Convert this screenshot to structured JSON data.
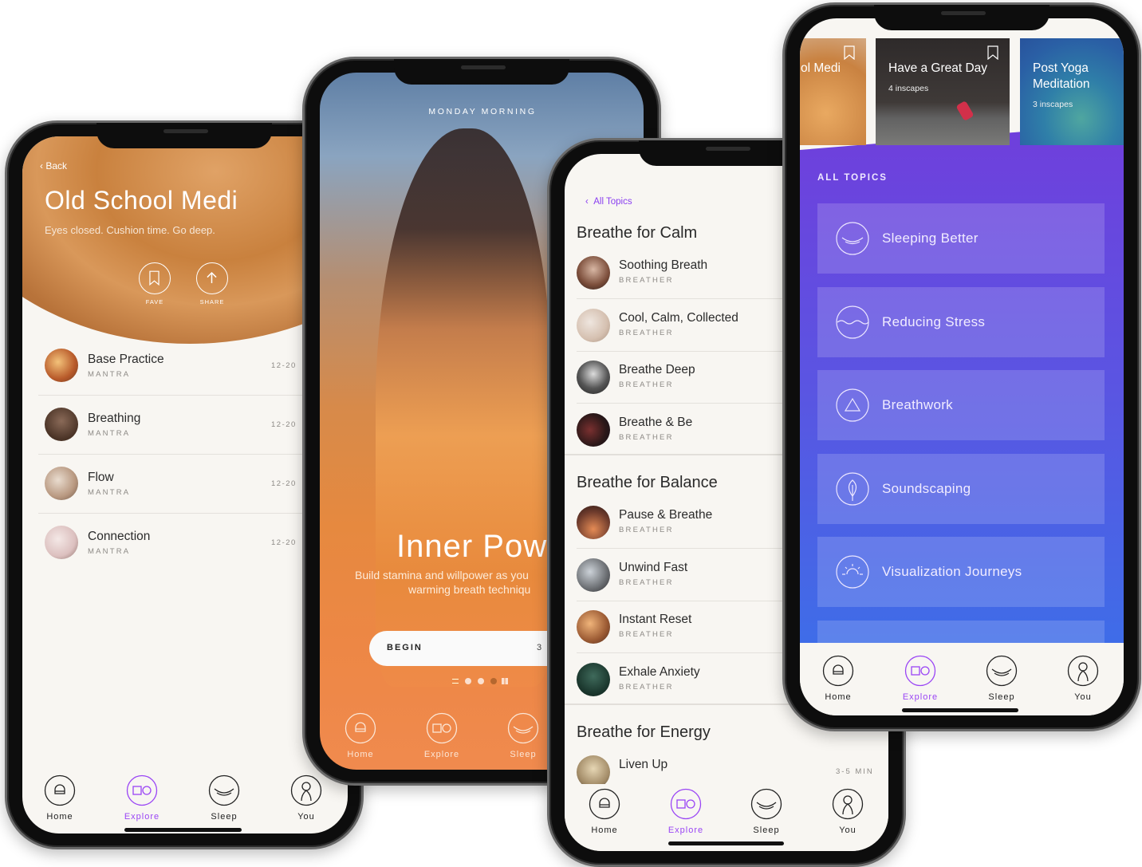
{
  "colors": {
    "accent": "#9a45f5",
    "cream": "#f8f6f2",
    "topics_top": "#6f3fdc",
    "topics_bottom": "#3e6de8"
  },
  "p1": {
    "back_label": "Back",
    "title": "Old School Medi",
    "subtitle": "Eyes closed. Cushion time. Go deep.",
    "fave_label": "FAVE",
    "share_label": "SHARE",
    "items": [
      {
        "title": "Base Practice",
        "subtitle": "MANTRA",
        "duration": "12-20"
      },
      {
        "title": "Breathing",
        "subtitle": "MANTRA",
        "duration": "12-20"
      },
      {
        "title": "Flow",
        "subtitle": "MANTRA",
        "duration": "12-20"
      },
      {
        "title": "Connection",
        "subtitle": "MANTRA",
        "duration": "12-20"
      }
    ],
    "active_tab": 1,
    "tabs": [
      {
        "label": "Home",
        "icon": "home-icon"
      },
      {
        "label": "Explore",
        "icon": "explore-icon"
      },
      {
        "label": "Sleep",
        "icon": "sleep-icon"
      },
      {
        "label": "You",
        "icon": "you-icon"
      }
    ]
  },
  "p2": {
    "kicker": "MONDAY MORNING",
    "title": "Inner Pow",
    "desc_line1": "Build stamina and willpower as you",
    "desc_line2": "warming breath techniqu",
    "begin_label": "BEGIN",
    "begin_value": "3",
    "pager_total": 3,
    "pager_active": 2,
    "tabs": [
      {
        "label": "Home",
        "icon": "home-icon"
      },
      {
        "label": "Explore",
        "icon": "explore-icon"
      },
      {
        "label": "Sleep",
        "icon": "sleep-icon"
      }
    ]
  },
  "p3": {
    "back_label": "All Topics",
    "sections": [
      {
        "title": "Breathe for Calm",
        "items": [
          {
            "title": "Soothing Breath",
            "subtitle": "BREATHER"
          },
          {
            "title": "Cool, Calm, Collected",
            "subtitle": "BREATHER"
          },
          {
            "title": "Breathe Deep",
            "subtitle": "BREATHER"
          },
          {
            "title": "Breathe & Be",
            "subtitle": "BREATHER"
          }
        ]
      },
      {
        "title": "Breathe for Balance",
        "items": [
          {
            "title": "Pause & Breathe",
            "subtitle": "BREATHER"
          },
          {
            "title": "Unwind Fast",
            "subtitle": "BREATHER"
          },
          {
            "title": "Instant Reset",
            "subtitle": "BREATHER"
          },
          {
            "title": "Exhale Anxiety",
            "subtitle": "BREATHER"
          }
        ]
      },
      {
        "title": "Breathe for Energy",
        "items": [
          {
            "title": "Liven Up",
            "duration": "3-5 MIN"
          }
        ]
      }
    ],
    "active_tab": 1,
    "tabs": [
      {
        "label": "Home",
        "icon": "home-icon"
      },
      {
        "label": "Explore",
        "icon": "explore-icon"
      },
      {
        "label": "Sleep",
        "icon": "sleep-icon"
      },
      {
        "label": "You",
        "icon": "you-icon"
      }
    ]
  },
  "p4": {
    "cards": [
      {
        "title": "ol Medi"
      },
      {
        "title": "Have a Great Day",
        "count": "4 inscapes"
      },
      {
        "title": "Post Yoga Meditation",
        "count": "3 inscapes"
      }
    ],
    "section_label": "ALL TOPICS",
    "topics": [
      {
        "label": "Sleeping Better",
        "icon": "smile-wave-icon"
      },
      {
        "label": "Reducing Stress",
        "icon": "wave-icon"
      },
      {
        "label": "Breathwork",
        "icon": "triangle-icon"
      },
      {
        "label": "Soundscaping",
        "icon": "leaf-icon"
      },
      {
        "label": "Visualization Journeys",
        "icon": "sunrise-icon"
      },
      {
        "label": "",
        "icon": ""
      }
    ],
    "active_tab": 1,
    "tabs": [
      {
        "label": "Home",
        "icon": "home-icon"
      },
      {
        "label": "Explore",
        "icon": "explore-icon"
      },
      {
        "label": "Sleep",
        "icon": "sleep-icon"
      },
      {
        "label": "You",
        "icon": "you-icon"
      }
    ]
  }
}
